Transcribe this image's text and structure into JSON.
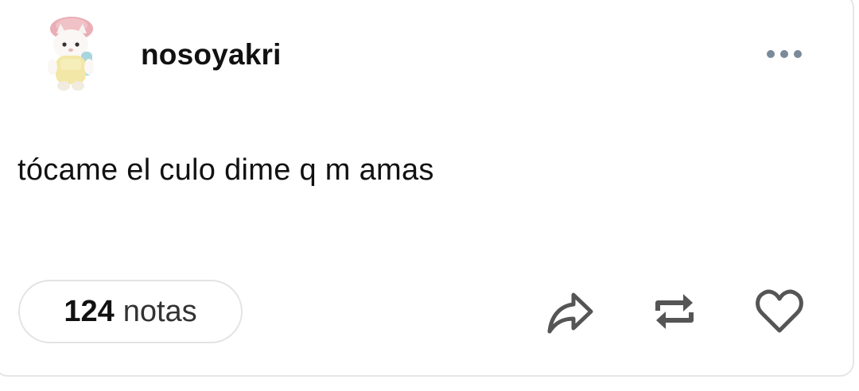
{
  "post": {
    "username": "nosoyakri",
    "text": "tócame el culo dime q m amas",
    "notes": {
      "count": "124",
      "label": "notas"
    }
  },
  "icons": {
    "avatar": "cat-plush-avatar",
    "more": "more-dots-icon",
    "share": "share-arrow-icon",
    "reblog": "reblog-icon",
    "like": "heart-icon"
  },
  "colors": {
    "text": "#111111",
    "icon": "#555555",
    "dots": "#7a8a99",
    "border": "#e3e3e3"
  }
}
